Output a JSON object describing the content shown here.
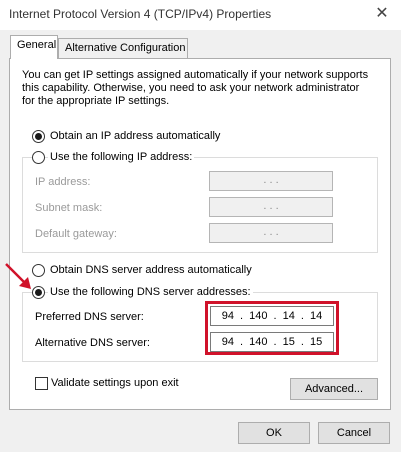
{
  "window": {
    "title": "Internet Protocol Version 4 (TCP/IPv4) Properties",
    "close_glyph": "✕"
  },
  "tabs": [
    {
      "label": "General",
      "active": true
    },
    {
      "label": "Alternative Configuration",
      "active": false
    }
  ],
  "description": {
    "line1": "You can get IP settings assigned automatically if your network supports",
    "line2": "this capability. Otherwise, you need to ask your network administrator",
    "line3": "for the appropriate IP settings."
  },
  "ip_section": {
    "obtain_auto_label": "Obtain an IP address automatically",
    "obtain_auto_checked": true,
    "use_following_label": "Use the following IP address:",
    "use_following_checked": false,
    "fields": [
      {
        "label": "IP address:",
        "value": ". . ."
      },
      {
        "label": "Subnet mask:",
        "value": ". . ."
      },
      {
        "label": "Default gateway:",
        "value": ". . ."
      }
    ]
  },
  "dns_section": {
    "obtain_auto_label": "Obtain DNS server address automatically",
    "obtain_auto_checked": false,
    "use_following_label": "Use the following DNS server addresses:",
    "use_following_checked": true,
    "preferred": {
      "label": "Preferred DNS server:",
      "value": "94 . 140 . 14 . 14"
    },
    "alternative": {
      "label": "Alternative DNS server:",
      "value": "94 . 140 . 15 . 15"
    },
    "highlight_color": "#d0122a"
  },
  "validate": {
    "label": "Validate settings upon exit",
    "checked": false
  },
  "buttons": {
    "advanced": "Advanced...",
    "ok": "OK",
    "cancel": "Cancel"
  }
}
